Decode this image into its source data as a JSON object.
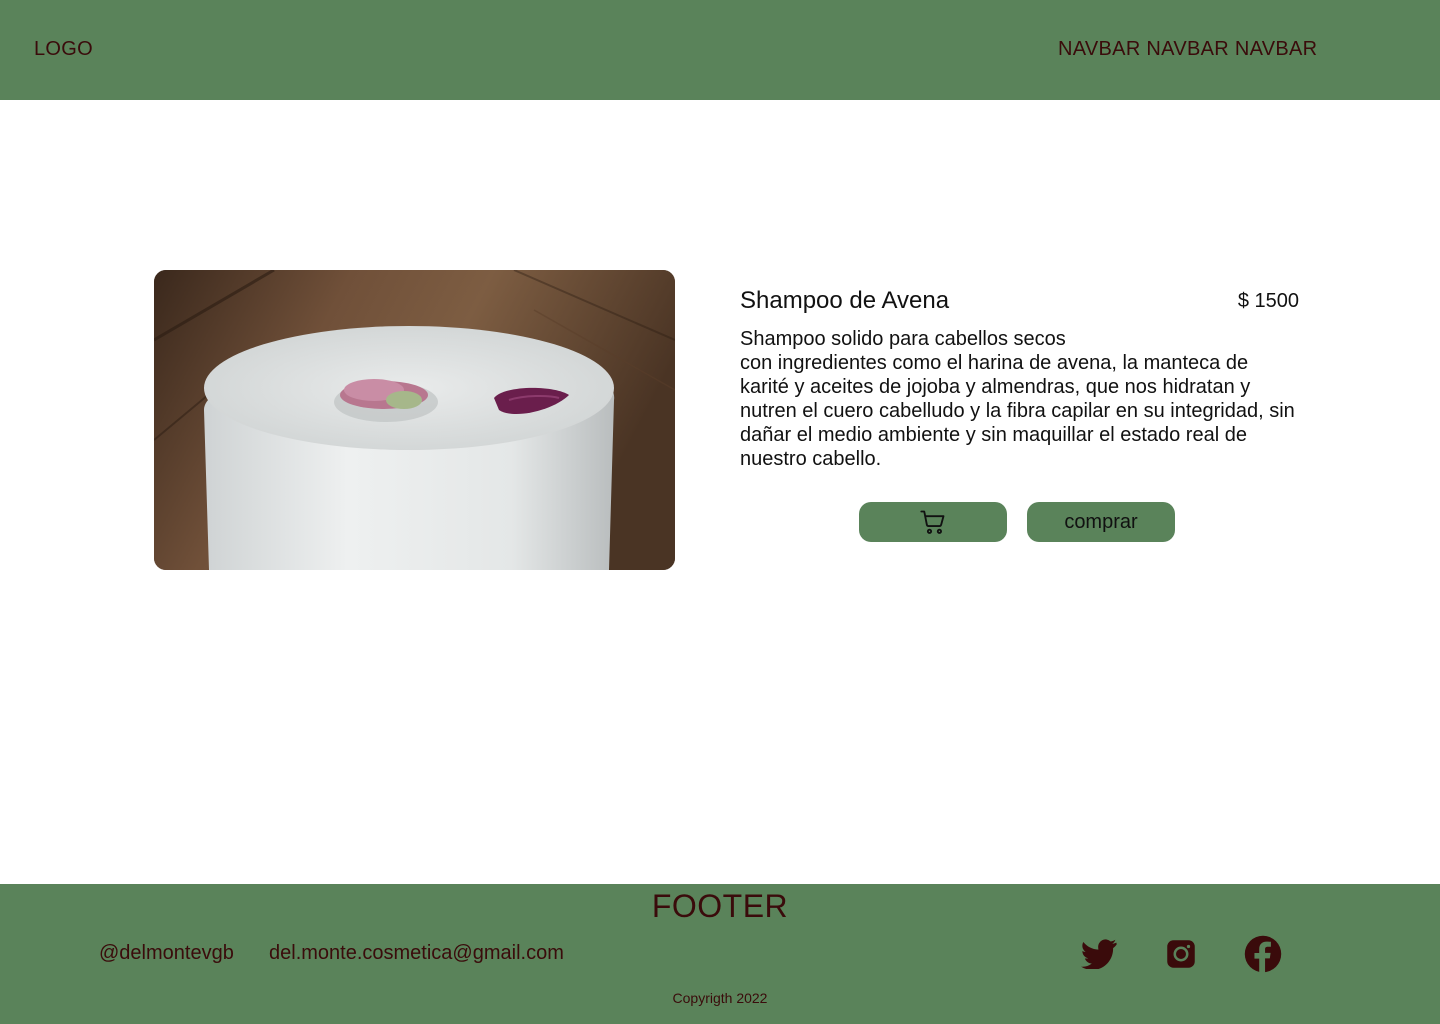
{
  "header": {
    "logo": "LOGO",
    "navbar": "NAVBAR NAVBAR NAVBAR"
  },
  "product": {
    "title": "Shampoo de Avena",
    "price": "$ 1500",
    "description_line1": "Shampoo solido para cabellos secos",
    "description_body": "con ingredientes como el harina de avena, la manteca de karité y aceites de jojoba y almendras, que nos hidratan y nutren el cuero cabelludo y la fibra capilar en su integridad, sin dañar el medio ambiente y sin maquillar el estado real de nuestro cabello.",
    "cart_icon": "shopping-cart-icon",
    "buy_label": "comprar"
  },
  "footer": {
    "title": "FOOTER",
    "handle": "@delmontevgb",
    "email": "del.monte.cosmetica@gmail.com",
    "social_icons": [
      "twitter-icon",
      "instagram-icon",
      "facebook-icon"
    ],
    "copyright": "Copyrigth 2022"
  },
  "colors": {
    "bar_green": "#5a835a",
    "dark_red_text": "#3a0b0b",
    "body_text": "#111111"
  }
}
